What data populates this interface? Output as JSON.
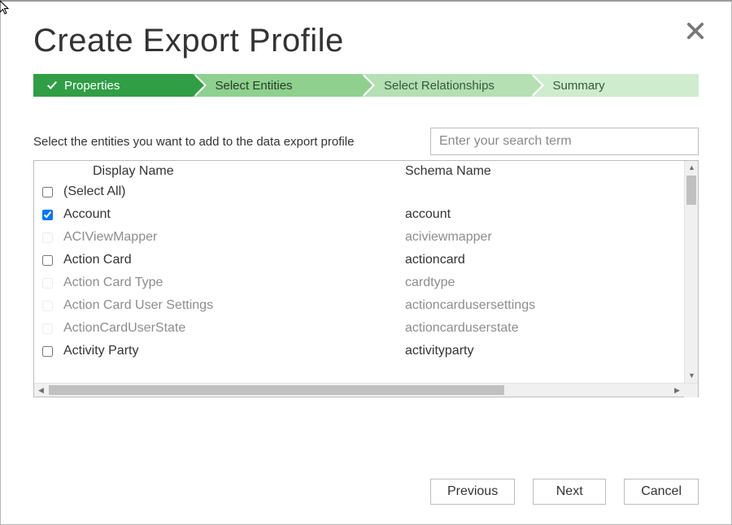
{
  "title": "Create Export Profile",
  "wizard": {
    "steps": [
      {
        "label": "Properties",
        "state": "done"
      },
      {
        "label": "Select Entities",
        "state": "active"
      },
      {
        "label": "Select Relationships",
        "state": "todo1"
      },
      {
        "label": "Summary",
        "state": "todo2"
      }
    ]
  },
  "instruction_text": "Select the entities you want to add to the data export profile",
  "search": {
    "placeholder": "Enter your search term",
    "value": ""
  },
  "grid": {
    "headers": {
      "display": "Display Name",
      "schema": "Schema Name"
    },
    "select_all_label": "(Select All)",
    "rows": [
      {
        "display": "Account",
        "schema": "account",
        "checked": true,
        "disabled": false
      },
      {
        "display": "ACIViewMapper",
        "schema": "aciviewmapper",
        "checked": false,
        "disabled": true
      },
      {
        "display": "Action Card",
        "schema": "actioncard",
        "checked": false,
        "disabled": false
      },
      {
        "display": "Action Card Type",
        "schema": "cardtype",
        "checked": false,
        "disabled": true
      },
      {
        "display": "Action Card User Settings",
        "schema": "actioncardusersettings",
        "checked": false,
        "disabled": true
      },
      {
        "display": "ActionCardUserState",
        "schema": "actioncarduserstate",
        "checked": false,
        "disabled": true
      },
      {
        "display": "Activity Party",
        "schema": "activityparty",
        "checked": false,
        "disabled": false
      }
    ]
  },
  "footer": {
    "previous_label": "Previous",
    "next_label": "Next",
    "cancel_label": "Cancel"
  }
}
